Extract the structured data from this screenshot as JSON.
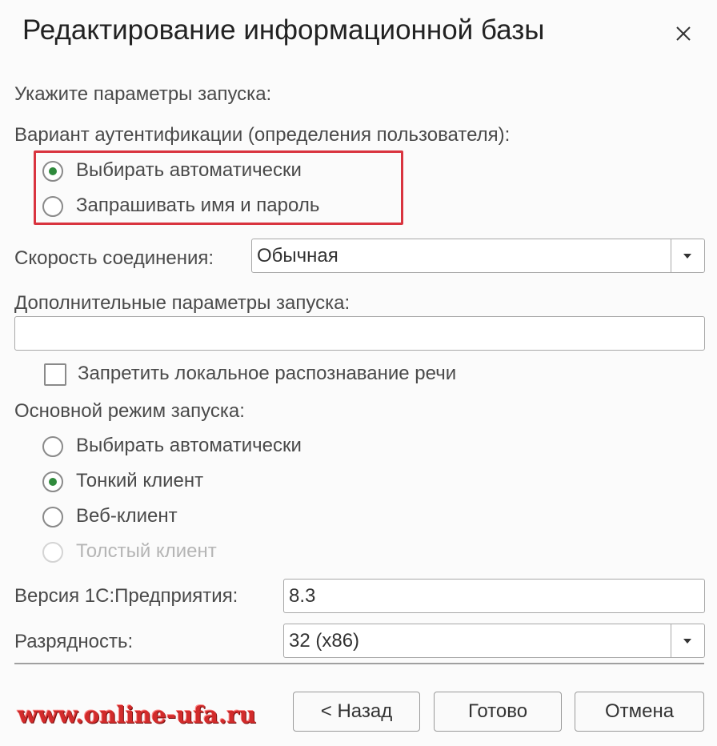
{
  "dialog": {
    "title": "Редактирование информационной базы",
    "close_icon": "close-icon"
  },
  "launch_params_label": "Укажите параметры запуска:",
  "auth": {
    "label": "Вариант аутентификации (определения пользователя):",
    "options": [
      {
        "label": "Выбирать автоматически",
        "checked": true
      },
      {
        "label": "Запрашивать имя и пароль",
        "checked": false
      }
    ],
    "highlight_color": "#d9343f"
  },
  "connection_speed": {
    "label": "Скорость соединения:",
    "value": "Обычная"
  },
  "extra_params": {
    "label": "Дополнительные параметры запуска:",
    "value": ""
  },
  "speech": {
    "label": "Запретить локальное распознавание речи",
    "checked": false
  },
  "launch_mode": {
    "label": "Основной режим запуска:",
    "options": [
      {
        "label": "Выбирать автоматически",
        "checked": false,
        "disabled": false
      },
      {
        "label": "Тонкий клиент",
        "checked": true,
        "disabled": false
      },
      {
        "label": "Веб-клиент",
        "checked": false,
        "disabled": false
      },
      {
        "label": "Толстый клиент",
        "checked": false,
        "disabled": true
      }
    ]
  },
  "version": {
    "label": "Версия 1С:Предприятия:",
    "value": "8.3"
  },
  "bitness": {
    "label": "Разрядность:",
    "value": "32 (x86)"
  },
  "buttons": {
    "back": "< Назад",
    "done": "Готово",
    "cancel": "Отмена"
  },
  "watermark": "www.online-ufa.ru",
  "colors": {
    "radio_selected": "#2f8a3c",
    "watermark": "#d22b2b"
  }
}
